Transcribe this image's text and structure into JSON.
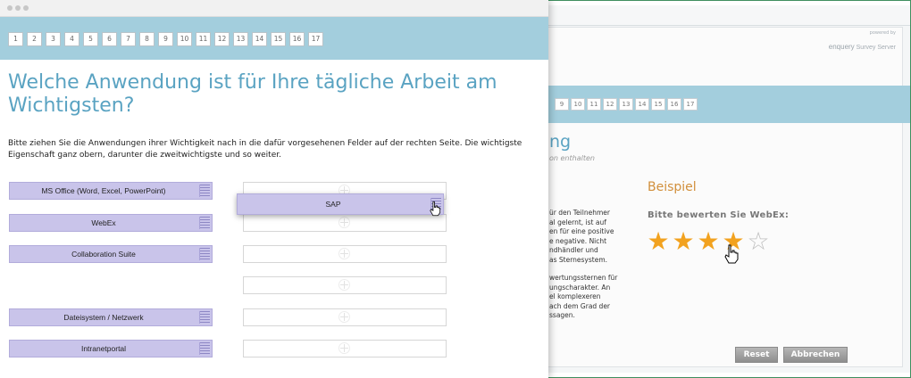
{
  "front": {
    "pages": [
      "1",
      "2",
      "3",
      "4",
      "5",
      "6",
      "7",
      "8",
      "9",
      "10",
      "11",
      "12",
      "13",
      "14",
      "15",
      "16",
      "17"
    ],
    "question": "Welche Anwendung ist für Ihre tägliche Arbeit am Wichtigsten?",
    "instructions": "Bitte ziehen Sie die Anwendungen ihrer Wichtigkeit nach in die dafür vorgesehenen Felder auf der rechten Seite. Die wichtigste Eigenschaft ganz obern, darunter die zweitwichtigste und so weiter.",
    "items": [
      "MS Office (Word, Excel, PowerPoint)",
      "WebEx",
      "Collaboration Suite",
      "Dateisystem / Netzwerk",
      "Intranetportal"
    ],
    "dragged_item": "SAP"
  },
  "back": {
    "powered_by": "powered by",
    "logo": "enquery",
    "logo_suffix": "Survey Server",
    "pages": [
      "9",
      "10",
      "11",
      "12",
      "13",
      "14",
      "15",
      "16",
      "17"
    ],
    "title_fragment": "ng",
    "subtitle_fragment": "on enthalten",
    "text_lines": [
      "ür den Teilnehmer",
      "al gelernt, ist auf",
      "en für eine positive",
      "e negative. Nicht",
      "ndhändler und",
      "as Sternesystem.",
      "",
      "wertungssternen für",
      "ungscharakter. An",
      "el komplexeren",
      "ach dem Grad der",
      "ssagen."
    ],
    "example_title": "Beispiel",
    "rating_question": "Bitte bewerten Sie WebEx:",
    "rating_value": 4,
    "rating_max": 5,
    "reset_label": "Reset",
    "cancel_label": "Abbrechen"
  },
  "colors": {
    "accent": "#5aa3c2",
    "teal": "#a3cedd",
    "item": "#c9c4ea",
    "star": "#f2a21f",
    "example": "#d18f3b"
  }
}
